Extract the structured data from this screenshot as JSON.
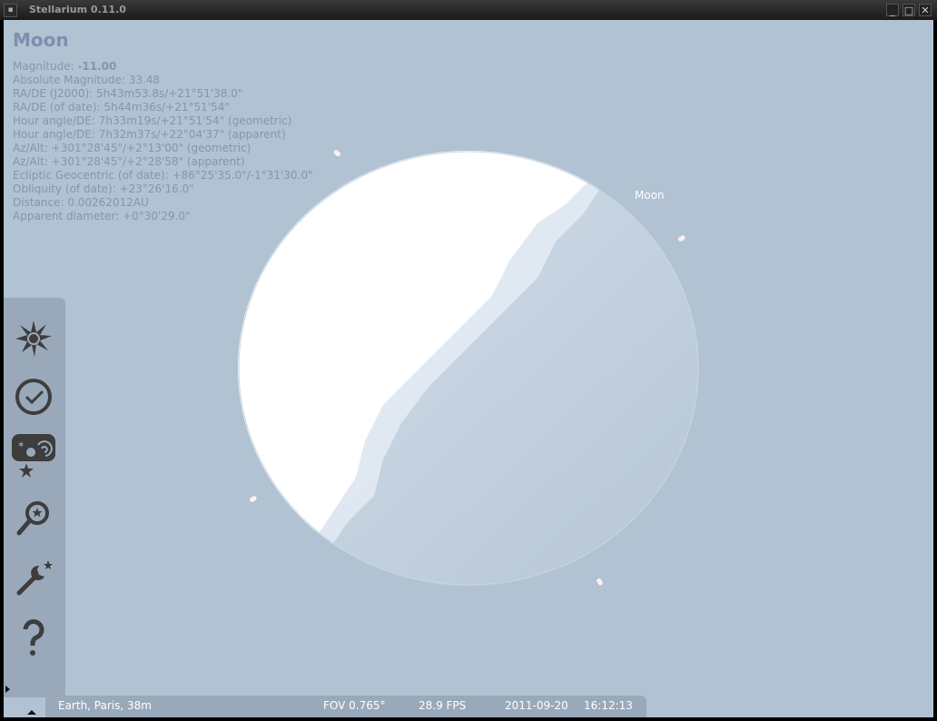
{
  "window": {
    "title": "Stellarium 0.11.0",
    "buttons": {
      "minimize": "_",
      "maximize": "□",
      "close": "✕"
    }
  },
  "info": {
    "object_name": "Moon",
    "magnitude_label": "Magnitude: ",
    "magnitude_value": "-11.00",
    "lines": [
      "Absolute Magnitude: 33.48",
      "RA/DE (J2000): 5h43m53.8s/+21°51'38.0\"",
      "RA/DE (of date): 5h44m36s/+21°51'54\"",
      "Hour angle/DE: 7h33m19s/+21°51'54\" (geometric)",
      "Hour angle/DE: 7h32m37s/+22°04'37\" (apparent)",
      "Az/Alt: +301°28'45\"/+2°13'00\" (geometric)",
      "Az/Alt: +301°28'45\"/+2°28'58\" (apparent)",
      "Ecliptic Geocentric (of date): +86°25'35.0\"/-1°31'30.0\"",
      "Obliquity (of date): +23°26'16.0\"",
      "Distance: 0.00262012AU",
      "Apparent diameter: +0°30'29.0\""
    ]
  },
  "sky": {
    "object_label": "Moon",
    "colors": {
      "sky": "#b1c2d2",
      "moon_lit": "#ffffff",
      "moon_dark": "#c5d2e0",
      "text": "#8495b3"
    }
  },
  "sidebar": {
    "buttons": [
      {
        "icon": "location-icon"
      },
      {
        "icon": "clock-icon"
      },
      {
        "icon": "sky-view-icon"
      },
      {
        "icon": "search-icon"
      },
      {
        "icon": "configuration-icon"
      },
      {
        "icon": "help-icon"
      }
    ]
  },
  "status": {
    "location": "Earth, Paris, 38m",
    "fov": "FOV 0.765°",
    "fps": "28.9 FPS",
    "date": "2011-09-20",
    "time": "16:12:13"
  }
}
